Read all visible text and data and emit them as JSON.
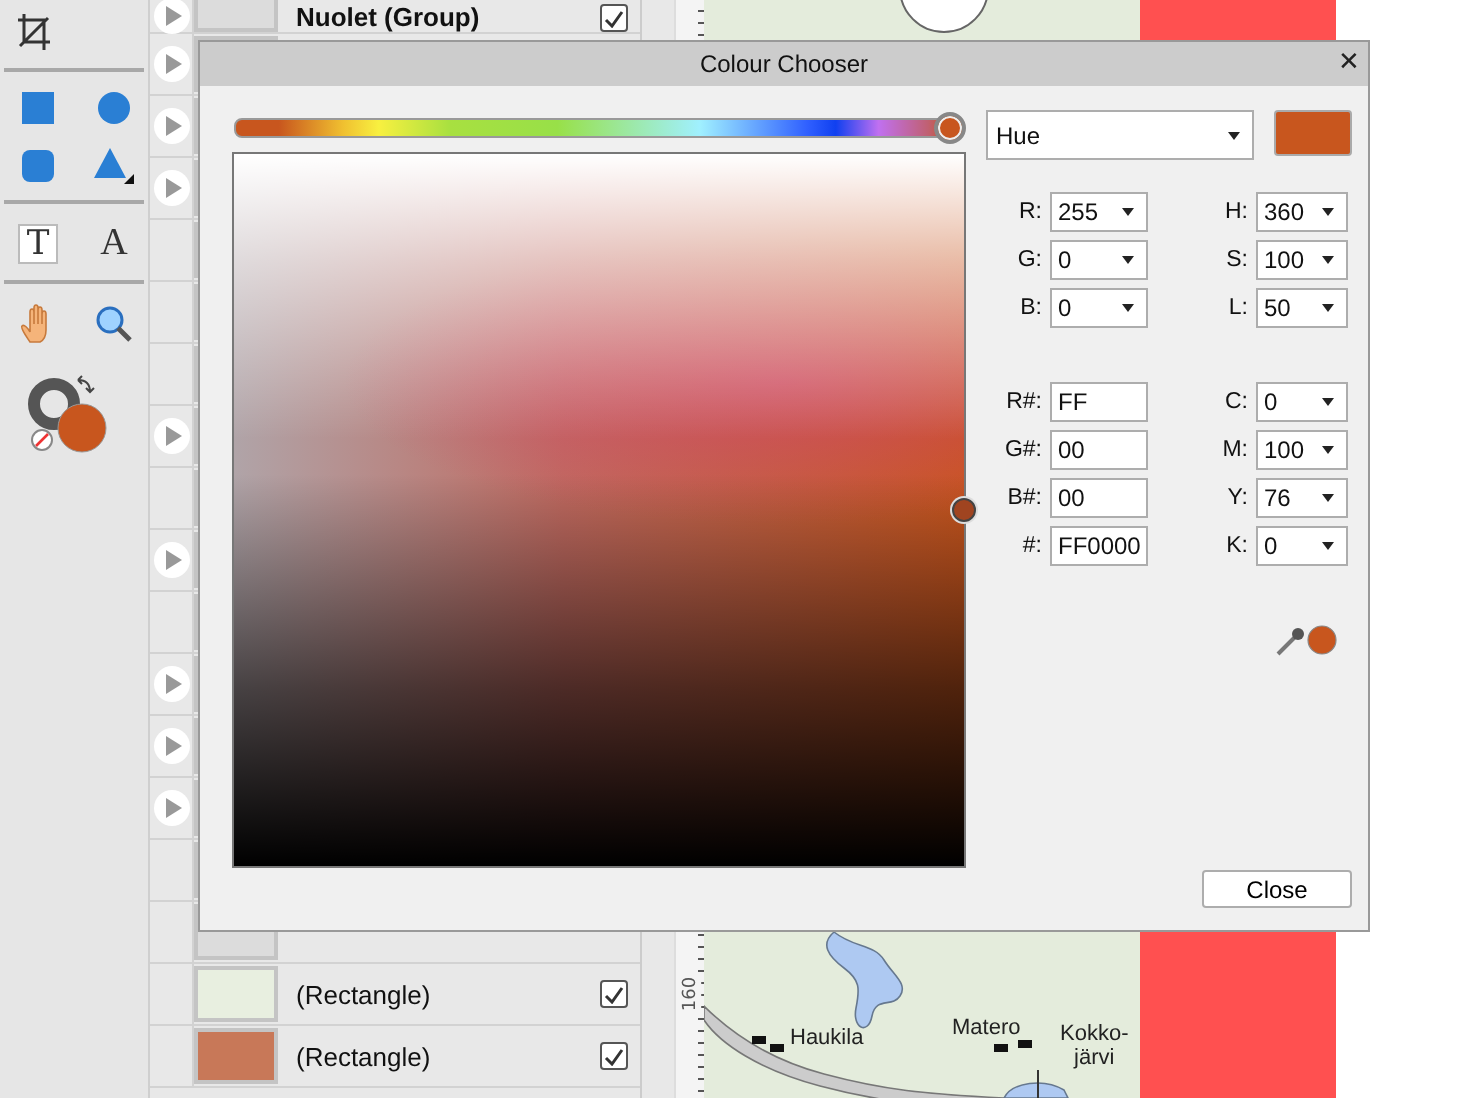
{
  "toolbar": {
    "tools": [
      {
        "kind": "text",
        "glyph": "T",
        "selected": true
      },
      {
        "kind": "artistic-text",
        "glyph": "A",
        "selected": false
      }
    ]
  },
  "layers": [
    {
      "expandable": true,
      "label": "Nuolet (Group)",
      "visible": true
    },
    {
      "expandable": true
    },
    {
      "expandable": true
    },
    {
      "expandable": true
    },
    {
      "expandable": false
    },
    {
      "expandable": false
    },
    {
      "expandable": false
    },
    {
      "expandable": true
    },
    {
      "expandable": false
    },
    {
      "expandable": true
    },
    {
      "expandable": false
    },
    {
      "expandable": true
    },
    {
      "expandable": true
    },
    {
      "expandable": true
    },
    {
      "expandable": false
    },
    {
      "expandable": false
    },
    {
      "expandable": false,
      "label": "(Rectangle)",
      "visible": true,
      "color": "#e8efe0"
    },
    {
      "expandable": false,
      "label": "(Rectangle)",
      "visible": true,
      "color": "#c87858"
    }
  ],
  "map": {
    "labels": [
      {
        "text": "Haukila"
      },
      {
        "text": "Matero"
      },
      {
        "text": "Kokko-\njärvi"
      }
    ],
    "ruler": "160"
  },
  "dialog": {
    "title": "Colour Chooser",
    "close": "✕",
    "hue_slider": {
      "level": 1.0
    },
    "picker": {
      "level": 0.5
    },
    "mode": "Hue",
    "fields_top": [
      {
        "label": "R:",
        "value": "255",
        "kind": "spin"
      },
      {
        "label": "H:",
        "value": "360",
        "kind": "spin"
      },
      {
        "label": "G:",
        "value": "0",
        "kind": "spin"
      },
      {
        "label": "S:",
        "value": "100",
        "kind": "spin"
      },
      {
        "label": "B:",
        "value": "0",
        "kind": "spin"
      },
      {
        "label": "L:",
        "value": "50",
        "kind": "spin"
      }
    ],
    "fields_bottom": [
      {
        "label": "R#:",
        "value": "FF",
        "kind": "text"
      },
      {
        "label": "C:",
        "value": "0",
        "kind": "spin"
      },
      {
        "label": "G#:",
        "value": "00",
        "kind": "text"
      },
      {
        "label": "M:",
        "value": "100",
        "kind": "spin"
      },
      {
        "label": "B#:",
        "value": "00",
        "kind": "text"
      },
      {
        "label": "Y:",
        "value": "76",
        "kind": "spin"
      },
      {
        "label": "#:",
        "value": "FF0000",
        "kind": "text"
      },
      {
        "label": "K:",
        "value": "0",
        "kind": "spin"
      }
    ],
    "button": "Close"
  }
}
